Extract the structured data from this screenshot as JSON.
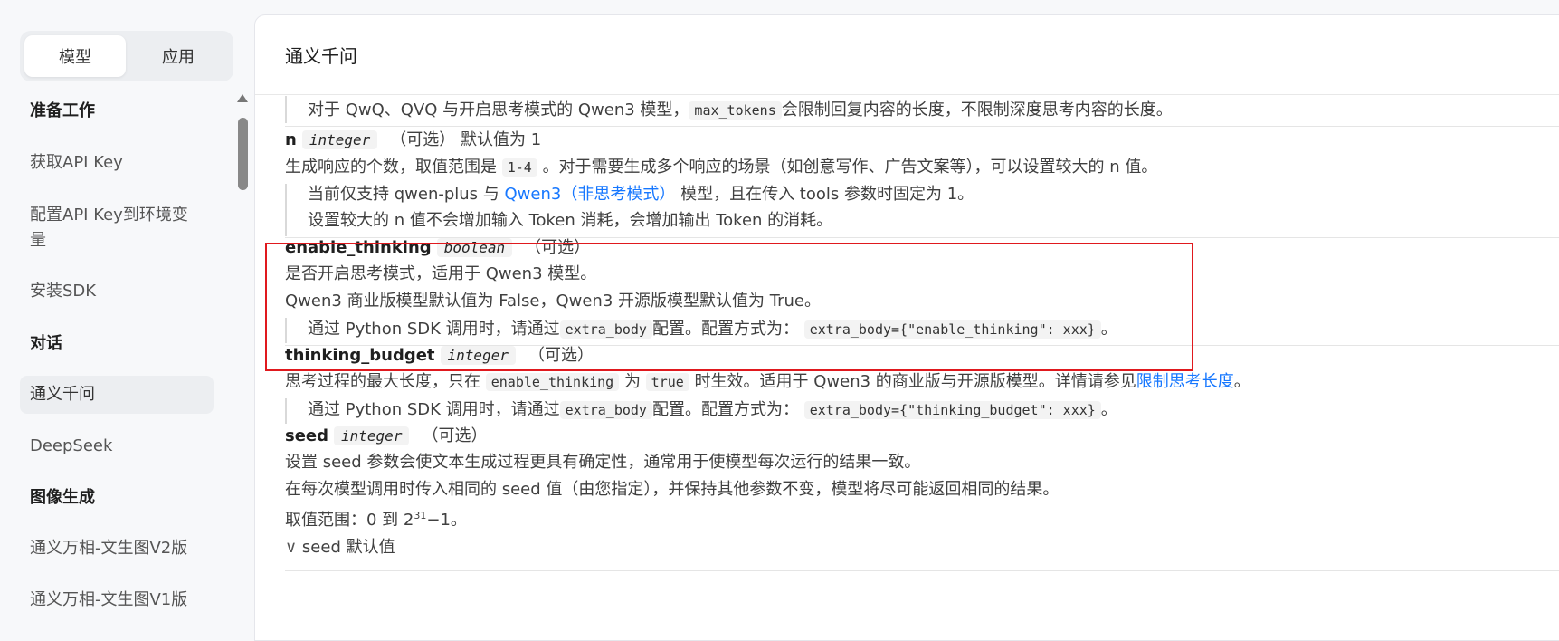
{
  "sidebar": {
    "tabs": [
      {
        "label": "模型",
        "active": true
      },
      {
        "label": "应用",
        "active": false
      }
    ],
    "nav": [
      {
        "label": "准备工作",
        "type": "section"
      },
      {
        "label": "获取API Key",
        "type": "item"
      },
      {
        "label": "配置API Key到环境变量",
        "type": "item"
      },
      {
        "label": "安装SDK",
        "type": "item"
      },
      {
        "label": "对话",
        "type": "section"
      },
      {
        "label": "通义千问",
        "type": "item",
        "active": true
      },
      {
        "label": "DeepSeek",
        "type": "item"
      },
      {
        "label": "图像生成",
        "type": "section"
      },
      {
        "label": "通义万相-文生图V2版",
        "type": "item"
      },
      {
        "label": "通义万相-文生图V1版",
        "type": "item"
      }
    ]
  },
  "main": {
    "title": "通义千问",
    "max_tokens_note": {
      "pre": "对于 QwQ、QVQ 与开启思考模式的 Qwen3 模型，",
      "code": "max_tokens",
      "post": "会限制回复内容的长度，不限制深度思考内容的长度。"
    },
    "n": {
      "name": "n",
      "type": "integer",
      "optional": "（可选）",
      "default": "默认值为 1",
      "desc_pre": "生成响应的个数，取值范围是",
      "desc_code": "1-4",
      "desc_post": "。对于需要生成多个响应的场景（如创意写作、广告文案等），可以设置较大的 n 值。",
      "note1_pre": "当前仅支持 qwen-plus 与",
      "note1_link": "Qwen3（非思考模式）",
      "note1_post": "模型，且在传入 tools 参数时固定为 1。",
      "note2": "设置较大的 n 值不会增加输入 Token 消耗，会增加输出 Token 的消耗。"
    },
    "enable_thinking": {
      "name": "enable_thinking",
      "type": "boolean",
      "optional": "（可选）",
      "desc1": "是否开启思考模式，适用于 Qwen3 模型。",
      "desc2": "Qwen3 商业版模型默认值为 False，Qwen3 开源版模型默认值为 True。",
      "note_pre": "通过 Python SDK 调用时，请通过",
      "note_code1": "extra_body",
      "note_mid": "配置。配置方式为：",
      "note_code2": "extra_body={\"enable_thinking\": xxx}",
      "note_post": "。"
    },
    "thinking_budget": {
      "name": "thinking_budget",
      "type": "integer",
      "optional": "（可选）",
      "desc_pre": "思考过程的最大长度，只在",
      "desc_code1": "enable_thinking",
      "desc_mid": "为",
      "desc_code2": "true",
      "desc_post": "时生效。适用于 Qwen3 的商业版与开源版模型。详情请参见",
      "desc_link": "限制思考长度",
      "desc_end": "。",
      "note_pre": "通过 Python SDK 调用时，请通过",
      "note_code1": "extra_body",
      "note_mid": "配置。配置方式为：",
      "note_code2": "extra_body={\"thinking_budget\": xxx}",
      "note_post": "。"
    },
    "seed": {
      "name": "seed",
      "type": "integer",
      "optional": "（可选）",
      "desc1": "设置 seed 参数会使文本生成过程更具有确定性，通常用于使模型每次运行的结果一致。",
      "desc2": "在每次模型调用时传入相同的 seed 值（由您指定），并保持其他参数不变，模型将尽可能返回相同的结果。",
      "range_pre": "取值范围：0 到 2",
      "range_sup": "31",
      "range_post": "−1。",
      "toggle_icon": "∨",
      "toggle_label": "seed 默认值"
    }
  }
}
